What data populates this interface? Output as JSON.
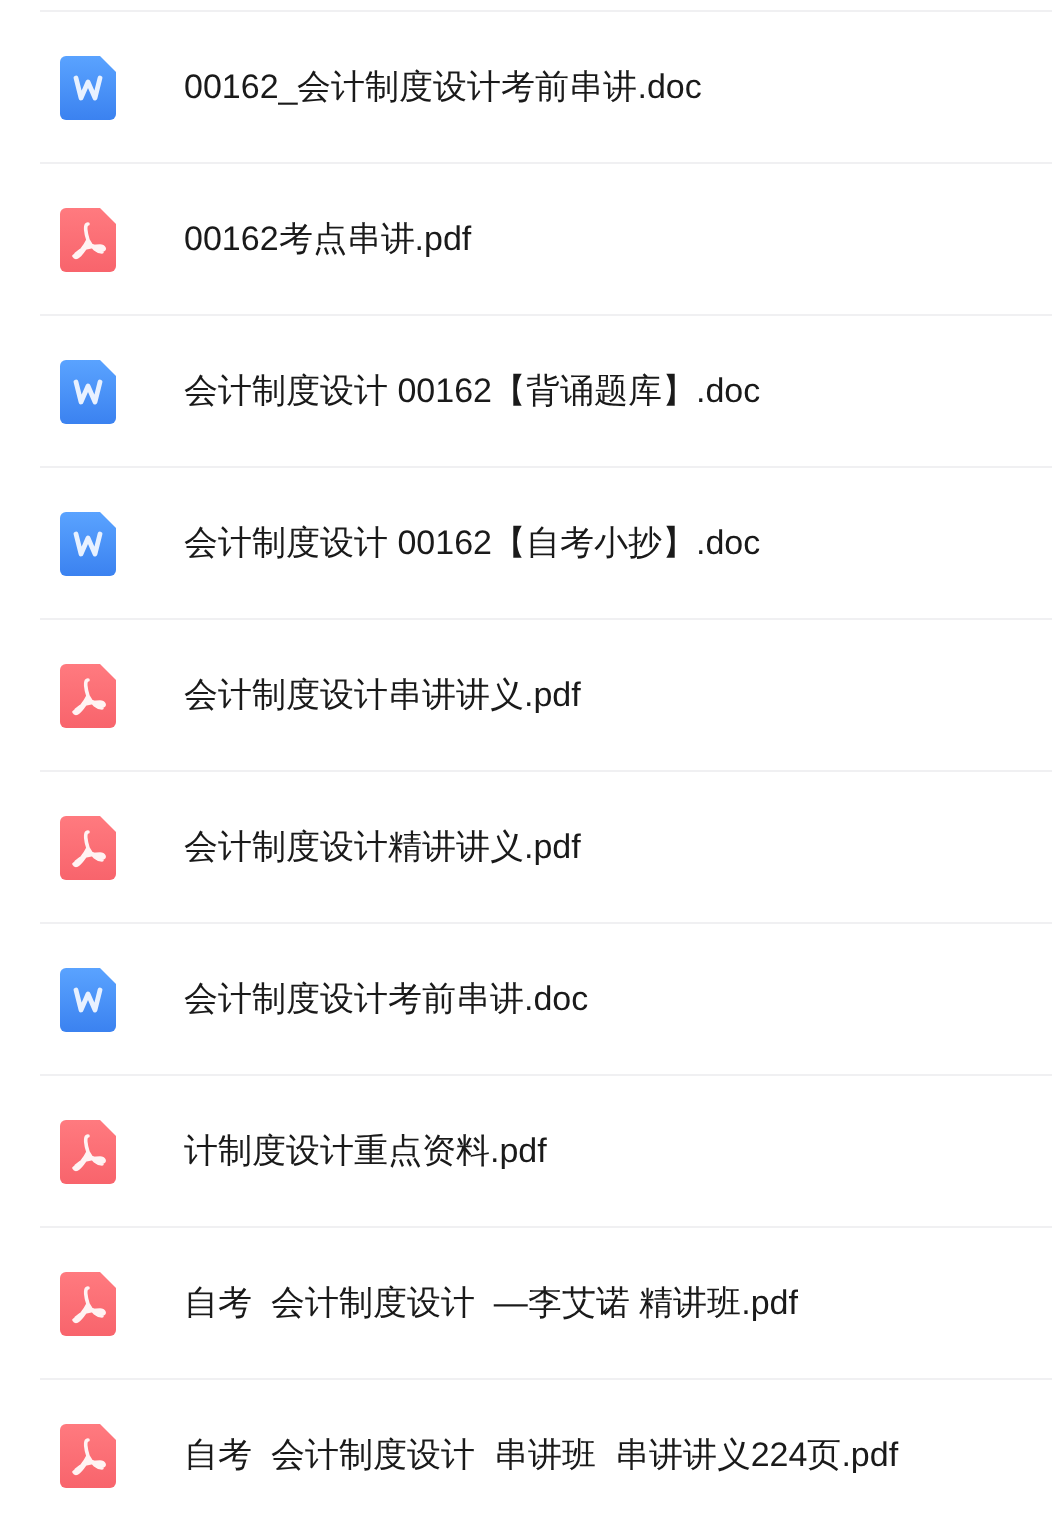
{
  "files": [
    {
      "kind": "doc",
      "name": "00162_会计制度设计考前串讲.doc"
    },
    {
      "kind": "pdf",
      "name": "00162考点串讲.pdf"
    },
    {
      "kind": "doc",
      "name": "会计制度设计 00162【背诵题库】.doc"
    },
    {
      "kind": "doc",
      "name": "会计制度设计 00162【自考小抄】.doc"
    },
    {
      "kind": "pdf",
      "name": "会计制度设计串讲讲义.pdf"
    },
    {
      "kind": "pdf",
      "name": "会计制度设计精讲讲义.pdf"
    },
    {
      "kind": "doc",
      "name": "会计制度设计考前串讲.doc"
    },
    {
      "kind": "pdf",
      "name": "计制度设计重点资料.pdf"
    },
    {
      "kind": "pdf",
      "name": "自考  会计制度设计  —李艾诺 精讲班.pdf"
    },
    {
      "kind": "pdf",
      "name": "自考  会计制度设计  串讲班  串讲讲义224页.pdf"
    }
  ]
}
